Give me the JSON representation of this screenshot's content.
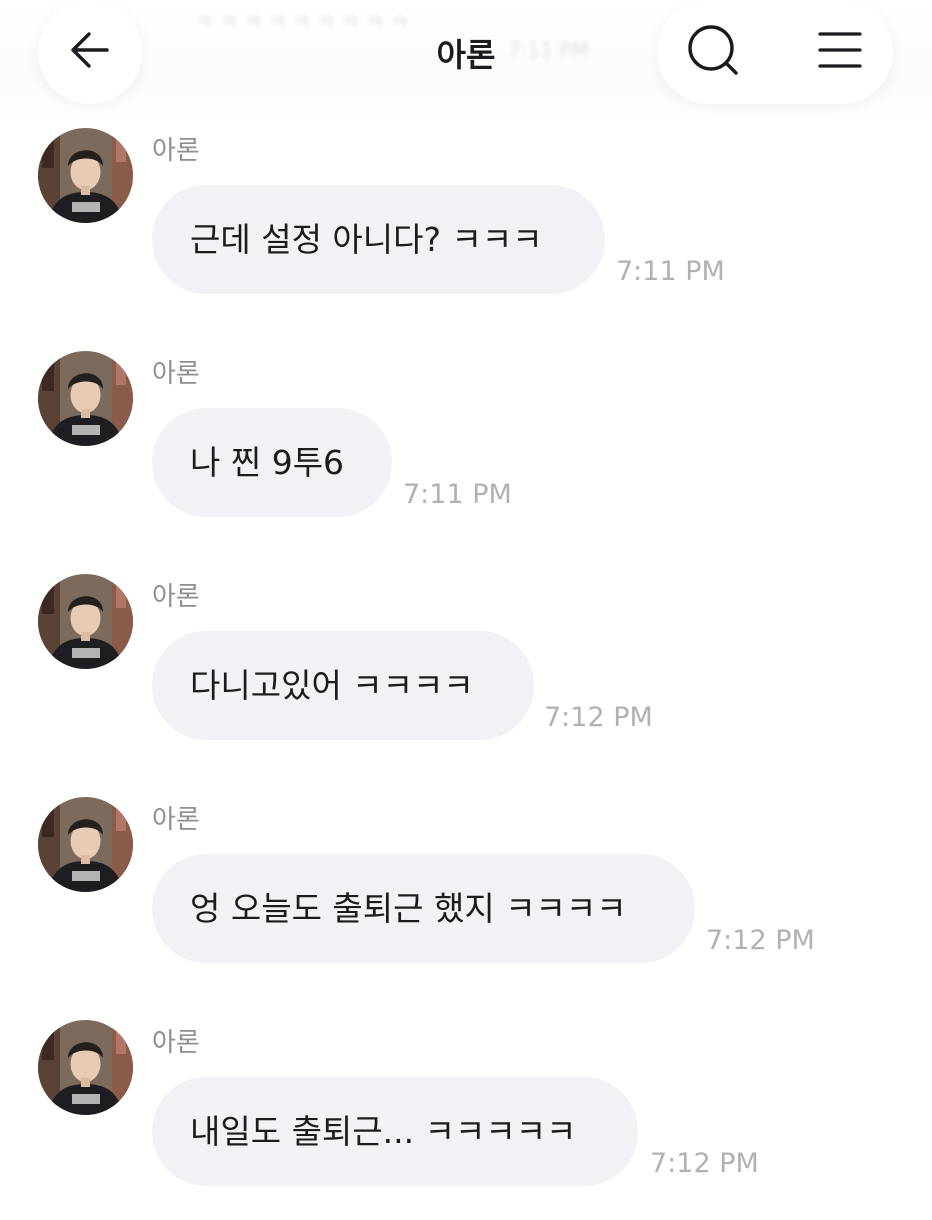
{
  "header": {
    "title": "아론",
    "faded_preview_text": "ㅋㅋㅋㅋㅋㅋㅋㅋㅋ",
    "faded_preview_time": "7:11 PM"
  },
  "icons": {
    "back": "arrow-left-icon",
    "search": "search-icon",
    "menu": "hamburger-menu-icon"
  },
  "colors": {
    "bubble": "#f2f2f6",
    "sender_text": "#8e8e93",
    "time_text": "#b0b0b5",
    "message_text": "#1c1c1e"
  },
  "messages": [
    {
      "sender": "아론",
      "text": "근데 설정 아니다? ㅋㅋㅋ",
      "time": "7:11 PM"
    },
    {
      "sender": "아론",
      "text": "나 찐 9투6",
      "time": "7:11 PM"
    },
    {
      "sender": "아론",
      "text": "다니고있어 ㅋㅋㅋㅋ",
      "time": "7:12 PM"
    },
    {
      "sender": "아론",
      "text": "엉 오늘도 출퇴근 했지 ㅋㅋㅋㅋ",
      "time": "7:12 PM"
    },
    {
      "sender": "아론",
      "text": "내일도 출퇴근... ㅋㅋㅋㅋㅋ",
      "time": "7:12 PM"
    }
  ]
}
